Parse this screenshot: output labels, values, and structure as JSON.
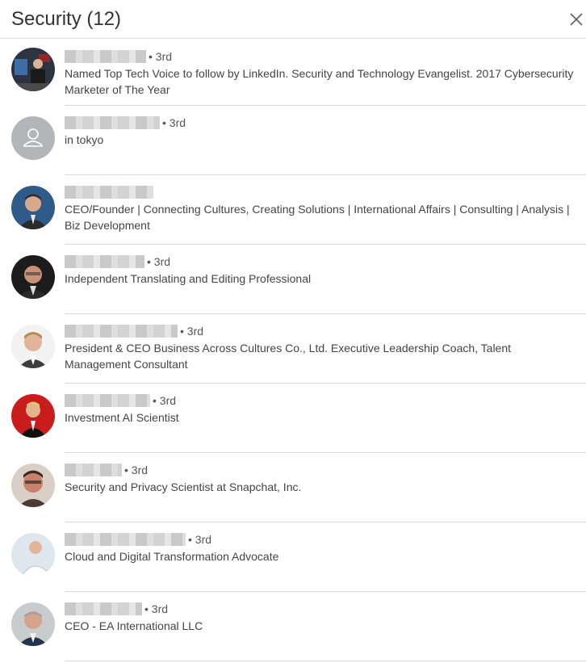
{
  "modal": {
    "title": "Security (12)",
    "close_icon": "close-icon"
  },
  "connections": [
    {
      "name_hidden": true,
      "degree": "• 3rd",
      "headline": "Named Top Tech Voice to follow by LinkedIn. Security and Technology Evangelist. 2017 Cybersecurity Marketer of The Year",
      "avatar": "photo"
    },
    {
      "name_hidden": true,
      "degree": "• 3rd",
      "headline": "in tokyo",
      "avatar": "placeholder"
    },
    {
      "name_hidden": true,
      "degree": "",
      "headline": "CEO/Founder | Connecting Cultures, Creating Solutions | International Affairs | Consulting | Analysis | Biz Development",
      "avatar": "photo"
    },
    {
      "name_hidden": true,
      "degree": "• 3rd",
      "headline": "Independent Translating and Editing Professional",
      "avatar": "photo"
    },
    {
      "name_hidden": true,
      "degree": "• 3rd",
      "headline": "President & CEO Business Across Cultures Co., Ltd. Executive Leadership Coach, Talent Management Consultant",
      "avatar": "photo"
    },
    {
      "name_hidden": true,
      "degree": "• 3rd",
      "headline": "Investment AI Scientist",
      "avatar": "photo"
    },
    {
      "name_hidden": true,
      "degree": "• 3rd",
      "headline": "Security and Privacy Scientist at Snapchat, Inc.",
      "avatar": "photo"
    },
    {
      "name_hidden": true,
      "degree": "• 3rd",
      "headline": "Cloud and Digital Transformation Advocate",
      "avatar": "photo"
    },
    {
      "name_hidden": true,
      "degree": "• 3rd",
      "headline": "CEO - EA International LLC",
      "avatar": "photo"
    }
  ]
}
